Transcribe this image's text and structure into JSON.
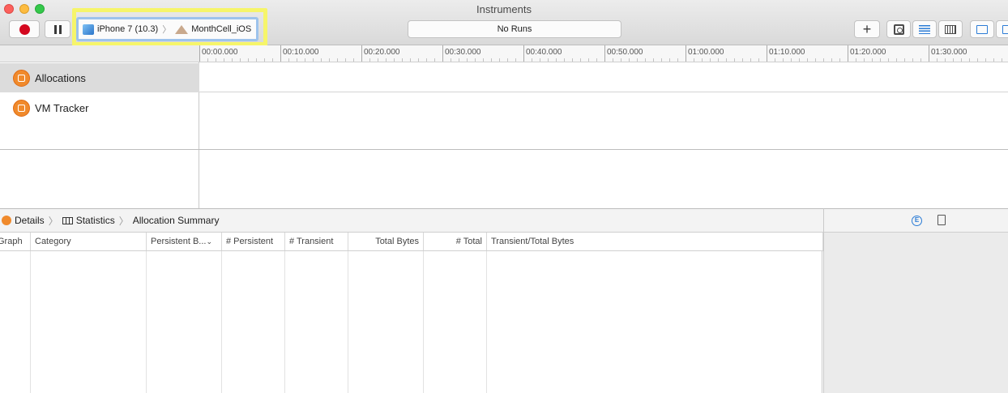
{
  "window": {
    "title": "Instruments"
  },
  "toolbar": {
    "device": "iPhone 7 (10.3)",
    "app": "MonthCell_iOS",
    "runs": "No Runs",
    "add_symbol": "+"
  },
  "ruler": {
    "ticks": [
      "00:00.000",
      "00:10.000",
      "00:20.000",
      "00:30.000",
      "00:40.000",
      "00:50.000",
      "01:00.000",
      "01:10.000",
      "01:20.000",
      "01:30.000"
    ]
  },
  "instruments": [
    {
      "name": "Allocations",
      "selected": true
    },
    {
      "name": "VM Tracker",
      "selected": false
    }
  ],
  "detail": {
    "breadcrumb": [
      "Details",
      "Statistics",
      "Allocation Summary"
    ]
  },
  "table": {
    "columns": [
      "Graph",
      "Category",
      "Persistent B...",
      "# Persistent",
      "# Transient",
      "Total Bytes",
      "# Total",
      "Transient/Total Bytes"
    ],
    "rows": []
  },
  "inspector": {
    "extended_icon_letter": "E"
  },
  "colors": {
    "record": "#d4081f",
    "instrument": "#f08a2c",
    "accent": "#2b7cd6",
    "highlight": "#f6f56a"
  }
}
